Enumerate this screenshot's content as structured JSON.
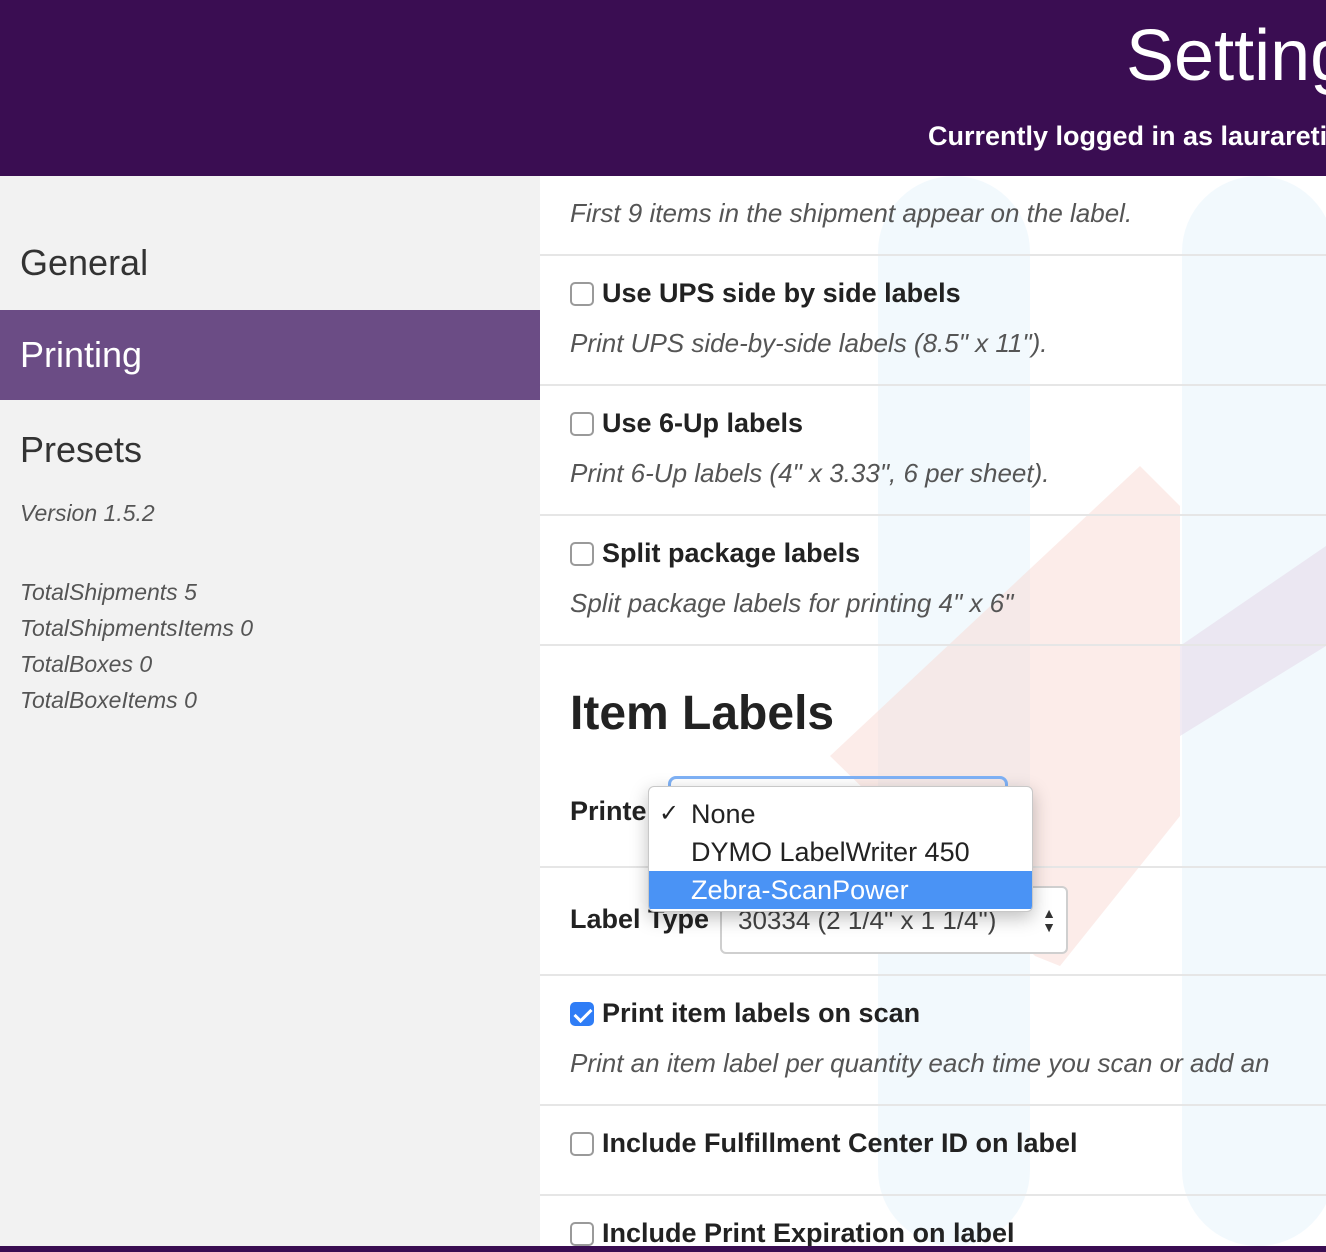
{
  "header": {
    "title": "Settings",
    "subtitle": "Currently logged in as laurareti"
  },
  "sidebar": {
    "items": [
      {
        "label": "General"
      },
      {
        "label": "Printing"
      },
      {
        "label": "Presets"
      }
    ],
    "version": "Version 1.5.2",
    "stats": [
      "TotalShipments 5",
      "TotalShipmentsItems 0",
      "TotalBoxes 0",
      "TotalBoxeItems 0"
    ]
  },
  "main": {
    "top_desc": "First 9 items in the shipment appear on the label.",
    "options": [
      {
        "label": "Use UPS side by side labels",
        "desc": "Print UPS side-by-side labels (8.5\" x 11\").",
        "checked": false
      },
      {
        "label": "Use 6-Up labels",
        "desc": "Print 6-Up labels (4\" x 3.33\", 6 per sheet).",
        "checked": false
      },
      {
        "label": "Split package labels",
        "desc": "Split package labels for printing 4\" x 6\"",
        "checked": false
      }
    ],
    "item_labels_title": "Item Labels",
    "printer_label": "Printer",
    "label_type_label": "Label Type",
    "label_type_value": "30334 (2 1/4\" x 1 1/4\")",
    "printer_dropdown": {
      "options": [
        "None",
        "DYMO LabelWriter 450",
        "Zebra-ScanPower"
      ],
      "selected": "None",
      "highlighted": "Zebra-ScanPower"
    },
    "print_on_scan": {
      "label": "Print item labels on scan",
      "desc": "Print an item label per quantity each time you scan or add an",
      "checked": true
    },
    "include_fc": {
      "label": "Include Fulfillment Center ID on label",
      "checked": false
    },
    "include_exp": {
      "label": "Include Print Expiration on label",
      "checked": false
    }
  },
  "colors": {
    "header_bg": "#3a0d52",
    "active_nav": "#6b4c85",
    "highlight": "#4a93f5",
    "checkbox_checked": "#2f7df6"
  }
}
